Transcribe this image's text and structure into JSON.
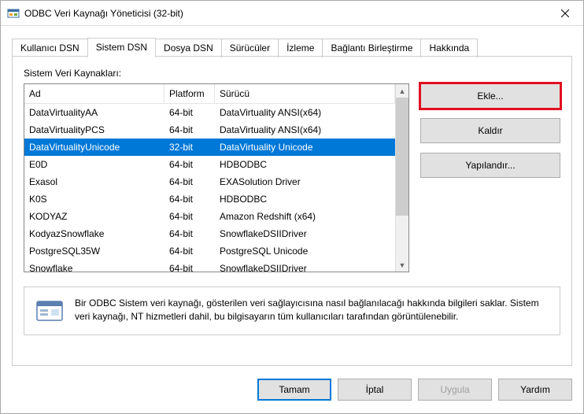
{
  "window": {
    "title": "ODBC Veri Kaynağı Yöneticisi (32-bit)"
  },
  "tabs": [
    {
      "label": "Kullanıcı DSN"
    },
    {
      "label": "Sistem DSN"
    },
    {
      "label": "Dosya DSN"
    },
    {
      "label": "Sürücüler"
    },
    {
      "label": "İzleme"
    },
    {
      "label": "Bağlantı Birleştirme"
    },
    {
      "label": "Hakkında"
    }
  ],
  "panel": {
    "label": "Sistem Veri Kaynakları:",
    "columns": {
      "name": "Ad",
      "platform": "Platform",
      "driver": "Sürücü"
    }
  },
  "dsn_rows": [
    {
      "name": "DataVirtualityAA",
      "platform": "64-bit",
      "driver": "DataVirtuality ANSI(x64)",
      "selected": false
    },
    {
      "name": "DataVirtualityPCS",
      "platform": "64-bit",
      "driver": "DataVirtuality ANSI(x64)",
      "selected": false
    },
    {
      "name": "DataVirtualityUnicode",
      "platform": "32-bit",
      "driver": "DataVirtuality Unicode",
      "selected": true
    },
    {
      "name": "E0D",
      "platform": "64-bit",
      "driver": "HDBODBC",
      "selected": false
    },
    {
      "name": "Exasol",
      "platform": "64-bit",
      "driver": "EXASolution Driver",
      "selected": false
    },
    {
      "name": "K0S",
      "platform": "64-bit",
      "driver": "HDBODBC",
      "selected": false
    },
    {
      "name": "KODYAZ",
      "platform": "64-bit",
      "driver": "Amazon Redshift (x64)",
      "selected": false
    },
    {
      "name": "KodyazSnowflake",
      "platform": "64-bit",
      "driver": "SnowflakeDSIIDriver",
      "selected": false
    },
    {
      "name": "PostgreSQL35W",
      "platform": "64-bit",
      "driver": "PostgreSQL Unicode",
      "selected": false
    },
    {
      "name": "Snowflake",
      "platform": "64-bit",
      "driver": "SnowflakeDSIIDriver",
      "selected": false
    }
  ],
  "buttons": {
    "add": "Ekle...",
    "remove": "Kaldır",
    "configure": "Yapılandır..."
  },
  "info": "Bir ODBC Sistem veri kaynağı, gösterilen veri sağlayıcısına nasıl bağlanılacağı hakkında bilgileri saklar. Sistem veri kaynağı, NT hizmetleri dahil, bu bilgisayarın tüm kullanıcıları tarafından görüntülenebilir.",
  "footer": {
    "ok": "Tamam",
    "cancel": "İptal",
    "apply": "Uygula",
    "help": "Yardım"
  }
}
